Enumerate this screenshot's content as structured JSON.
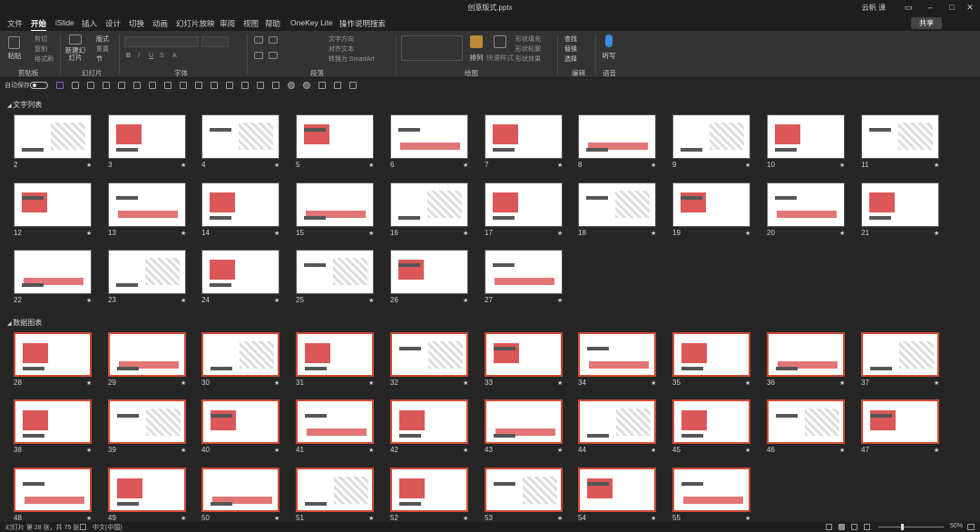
{
  "window": {
    "title": "创意版式.pptx",
    "user": "云帆 课"
  },
  "menu": {
    "tabs": [
      "文件",
      "开始",
      "iSlide",
      "插入",
      "设计",
      "切换",
      "动画",
      "幻灯片放映",
      "审阅",
      "视图",
      "帮助",
      "OneKey Lite",
      "操作说明搜索"
    ],
    "active": "开始",
    "share": "共享"
  },
  "ribbon": {
    "clipboard": {
      "paste": "粘贴",
      "cut": "剪切",
      "copy": "复制",
      "format_painter": "格式刷",
      "label": "剪贴板"
    },
    "slides": {
      "new_slide": "新建幻灯片",
      "layout": "版式",
      "reset": "重置",
      "section": "节",
      "label": "幻灯片"
    },
    "font": {
      "label": "字体"
    },
    "paragraph": {
      "text_direction": "文字方向",
      "align_text": "对齐文本",
      "smartart": "转换为 SmartArt",
      "label": "段落"
    },
    "drawing": {
      "arrange": "排列",
      "quick_styles": "快速样式",
      "shape_fill": "形状填充",
      "shape_outline": "形状轮廓",
      "shape_effects": "形状效果",
      "label": "绘图"
    },
    "editing": {
      "find": "查找",
      "replace": "替换",
      "select": "选择",
      "label": "编辑"
    },
    "voice": {
      "dictate": "听写",
      "label": "语音"
    }
  },
  "qat": {
    "autosave": "自动保存"
  },
  "sections": [
    {
      "title": "文字列表",
      "rows": [
        [
          2,
          3,
          4,
          5,
          6,
          7,
          8,
          9,
          10,
          11
        ],
        [
          12,
          13,
          14,
          15,
          16,
          17,
          18,
          19,
          20,
          21
        ],
        [
          22,
          23,
          24,
          25,
          26,
          27
        ]
      ]
    },
    {
      "title": "数据图表",
      "rows": [
        [
          28,
          29,
          30,
          31,
          32,
          33,
          34,
          35,
          36,
          37
        ],
        [
          38,
          39,
          40,
          41,
          42,
          43,
          44,
          45,
          46,
          47
        ],
        [
          48,
          49,
          50,
          51,
          52,
          53,
          54,
          55
        ]
      ]
    }
  ],
  "status": {
    "slide_info": "幻灯片 第 28 张，共 75 张",
    "language": "中文(中国)",
    "zoom": "50%"
  }
}
